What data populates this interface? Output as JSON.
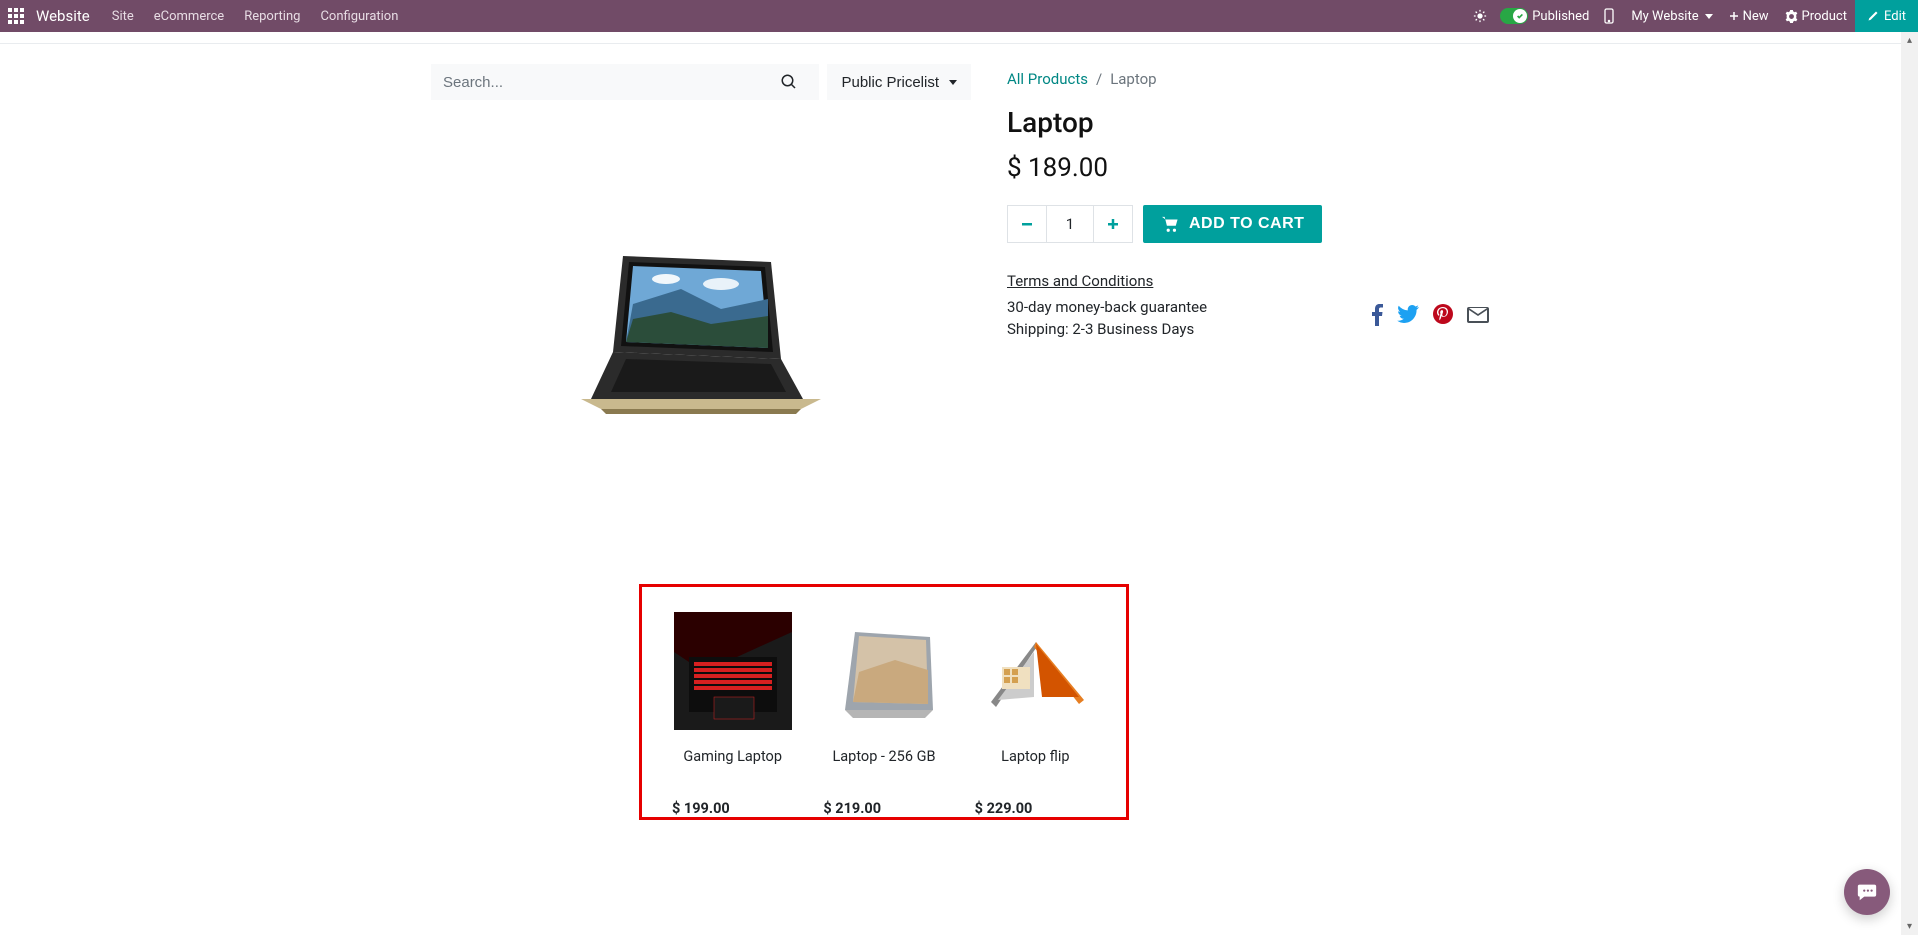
{
  "topbar": {
    "brand": "Website",
    "nav": [
      "Site",
      "eCommerce",
      "Reporting",
      "Configuration"
    ],
    "published_label": "Published",
    "my_website_label": "My Website",
    "new_label": "New",
    "product_label": "Product",
    "edit_label": "Edit"
  },
  "search": {
    "placeholder": "Search...",
    "pricelist_label": "Public Pricelist"
  },
  "breadcrumb": {
    "root": "All Products",
    "current": "Laptop"
  },
  "product": {
    "title": "Laptop",
    "price": "$ 189.00",
    "qty": "1",
    "add_to_cart": "ADD TO CART",
    "terms": "Terms and Conditions",
    "guarantee": "30-day money-back guarantee",
    "shipping": "Shipping: 2-3 Business Days"
  },
  "related": [
    {
      "name": "Gaming Laptop",
      "price": "$ 199.00"
    },
    {
      "name": "Laptop - 256 GB",
      "price": "$ 219.00"
    },
    {
      "name": "Laptop flip",
      "price": "$ 229.00"
    }
  ]
}
